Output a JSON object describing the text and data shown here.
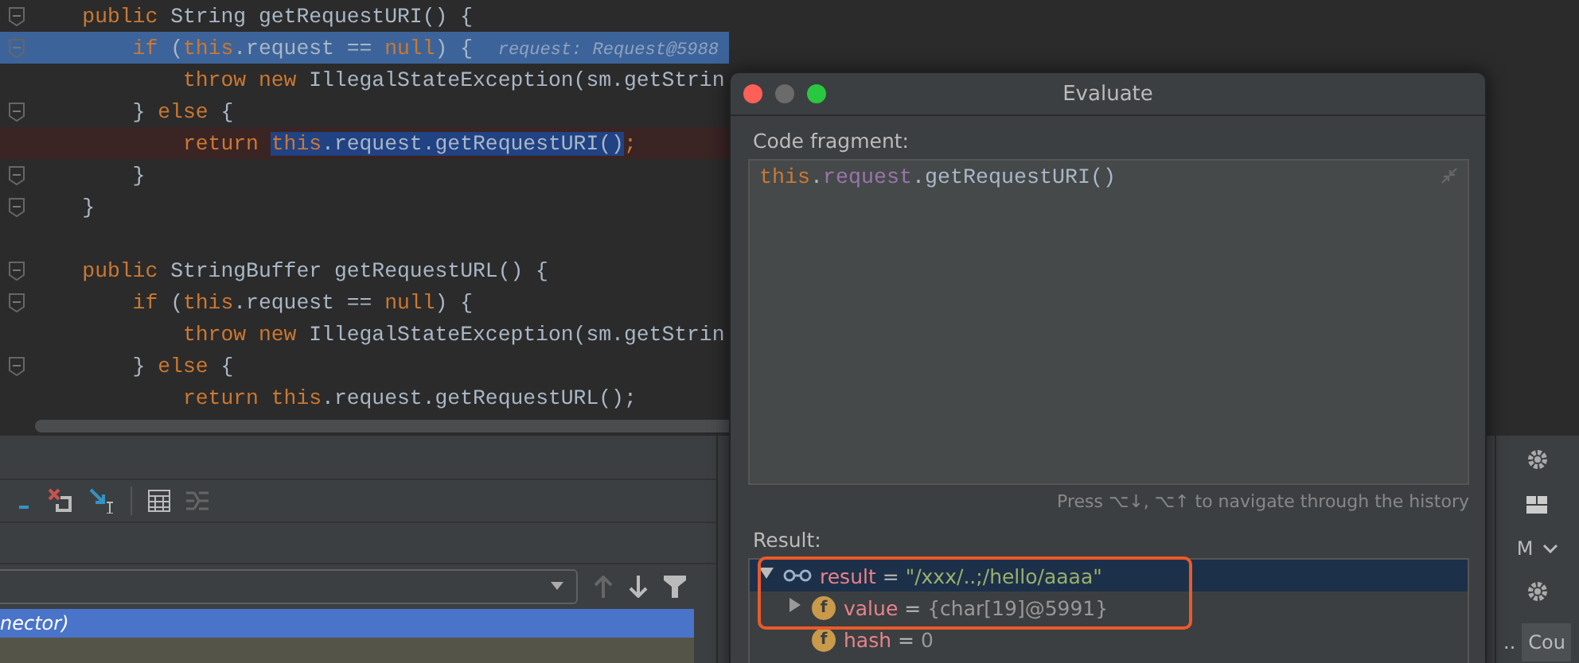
{
  "editor": {
    "lines": [
      {
        "fold": true,
        "kind": "plain",
        "tokens": [
          {
            "text": "    public ",
            "kind": "keyword"
          },
          {
            "text": "String getRequestURI() {",
            "kind": "plain"
          }
        ]
      },
      {
        "fold": true,
        "kind": "current",
        "tokens": [
          {
            "text": "        if ",
            "kind": "keyword"
          },
          {
            "text": "(",
            "kind": "plain"
          },
          {
            "text": "this",
            "kind": "keyword"
          },
          {
            "text": ".request == ",
            "kind": "plain"
          },
          {
            "text": "null",
            "kind": "keyword"
          },
          {
            "text": ") {  ",
            "kind": "plain"
          },
          {
            "text": "request: Request@5988",
            "kind": "hint"
          }
        ]
      },
      {
        "fold": false,
        "kind": "plain",
        "tokens": [
          {
            "text": "            throw new ",
            "kind": "keyword"
          },
          {
            "text": "IllegalStateException(sm.getStrin",
            "kind": "plain"
          }
        ]
      },
      {
        "fold": true,
        "kind": "plain",
        "tokens": [
          {
            "text": "        } ",
            "kind": "plain"
          },
          {
            "text": "else ",
            "kind": "keyword"
          },
          {
            "text": "{",
            "kind": "plain"
          }
        ]
      },
      {
        "fold": false,
        "kind": "breakpoint",
        "tokens": [
          {
            "text": "            return ",
            "kind": "keyword"
          },
          {
            "text": "this",
            "kind": "selkeyword"
          },
          {
            "text": ".request.getRequestURI()",
            "kind": "selplain"
          },
          {
            "text": ";",
            "kind": "keyword"
          }
        ]
      },
      {
        "fold": true,
        "kind": "plain",
        "tokens": [
          {
            "text": "        }",
            "kind": "plain"
          }
        ]
      },
      {
        "fold": true,
        "kind": "plain",
        "tokens": [
          {
            "text": "    }",
            "kind": "plain"
          }
        ]
      },
      {
        "fold": false,
        "kind": "plain"
      },
      {
        "fold": true,
        "kind": "plain",
        "tokens": [
          {
            "text": "    public ",
            "kind": "keyword"
          },
          {
            "text": "StringBuffer getRequestURL() {",
            "kind": "plain"
          }
        ]
      },
      {
        "fold": true,
        "kind": "plain",
        "tokens": [
          {
            "text": "        if ",
            "kind": "keyword"
          },
          {
            "text": "(",
            "kind": "plain"
          },
          {
            "text": "this",
            "kind": "keyword"
          },
          {
            "text": ".request == ",
            "kind": "plain"
          },
          {
            "text": "null",
            "kind": "keyword"
          },
          {
            "text": ") {",
            "kind": "plain"
          }
        ]
      },
      {
        "fold": false,
        "kind": "plain",
        "tokens": [
          {
            "text": "            throw new ",
            "kind": "keyword"
          },
          {
            "text": "IllegalStateException(sm.getStrin",
            "kind": "plain"
          }
        ]
      },
      {
        "fold": true,
        "kind": "plain",
        "tokens": [
          {
            "text": "        } ",
            "kind": "plain"
          },
          {
            "text": "else ",
            "kind": "keyword"
          },
          {
            "text": "{",
            "kind": "plain"
          }
        ]
      },
      {
        "fold": false,
        "kind": "plain",
        "tokens": [
          {
            "text": "            return this",
            "kind": "keyword"
          },
          {
            "text": ".request.getRequestURL();",
            "kind": "plain"
          }
        ]
      }
    ]
  },
  "debug_panel": {
    "frames": [
      {
        "text": "nector)",
        "selected": true
      },
      {
        "selected": false
      }
    ],
    "side": {
      "mode_dropdown": "M",
      "button": "Cou",
      "dots": ".."
    }
  },
  "evaluate_dialog": {
    "title": "Evaluate",
    "code_label": "Code fragment:",
    "code": [
      {
        "text": "this",
        "kind": "keyword"
      },
      {
        "text": ".",
        "kind": "plain"
      },
      {
        "text": "request",
        "kind": "field"
      },
      {
        "text": ".getRequestURI()",
        "kind": "plain"
      }
    ],
    "history_hint": "Press ⌥↓, ⌥↑ to navigate through the history",
    "result_label": "Result:",
    "result_tree": [
      {
        "kind": "watch",
        "name": "result",
        "equals": "=",
        "value": "\"/xxx/..;/hello/aaaa\"",
        "selected": true,
        "expanded": true,
        "children": [
          {
            "kind": "field",
            "badge": "f",
            "name": "value",
            "equals": "=",
            "value": "{char[19]@5991}",
            "selected": false,
            "expanded": false
          },
          {
            "kind": "field",
            "badge": "f",
            "name": "hash",
            "equals": "=",
            "value": "0",
            "selected": false
          }
        ]
      }
    ]
  }
}
